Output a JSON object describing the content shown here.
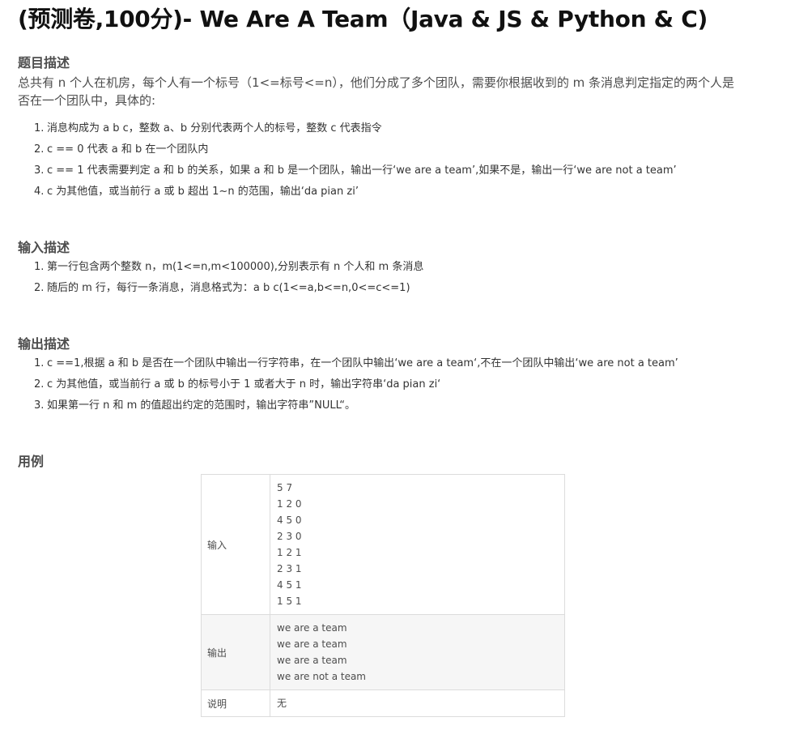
{
  "title": "(预测卷,100分)- We Are A Team（Java & JS & Python & C)",
  "description": {
    "heading": "题目描述",
    "paragraph": "总共有 n 个人在机房，每个人有一个标号（1<=标号<=n），他们分成了多个团队，需要你根据收到的 m 条消息判定指定的两个人是否在一个团队中，具体的:",
    "items": [
      {
        "num": "1.",
        "text": "消息构成为 a b c，整数 a、b 分别代表两个人的标号，整数 c 代表指令"
      },
      {
        "num": "2.",
        "text": "c == 0 代表 a 和 b 在一个团队内"
      },
      {
        "num": "3.",
        "text": "c == 1 代表需要判定 a 和 b 的关系，如果 a 和 b 是一个团队，输出一行‘we are a team’,如果不是，输出一行‘we are not a team’"
      },
      {
        "num": "4.",
        "text": "c 为其他值，或当前行 a 或 b 超出 1~n 的范围，输出‘da pian zi’"
      }
    ]
  },
  "input_desc": {
    "heading": "输入描述",
    "items": [
      {
        "num": "1.",
        "text": "第一行包含两个整数 n，m(1<=n,m<100000),分别表示有 n 个人和 m 条消息"
      },
      {
        "num": "2.",
        "text": "随后的 m 行，每行一条消息，消息格式为：a b c(1<=a,b<=n,0<=c<=1)"
      }
    ]
  },
  "output_desc": {
    "heading": "输出描述",
    "items": [
      {
        "num": "1.",
        "text": "c ==1,根据 a 和 b 是否在一个团队中输出一行字符串，在一个团队中输出‘we are a team‘,不在一个团队中输出‘we are not a team’"
      },
      {
        "num": "2.",
        "text": "c 为其他值，或当前行 a 或 b 的标号小于 1 或者大于 n 时，输出字符串‘da pian zi‘"
      },
      {
        "num": "3.",
        "text": "如果第一行 n 和 m 的值超出约定的范围时，输出字符串”NULL“。"
      }
    ]
  },
  "example": {
    "heading": "用例",
    "input_label": "输入",
    "input_lines": [
      "5 7",
      "1 2 0",
      "4 5 0",
      "2 3 0",
      "1 2 1",
      "2 3 1",
      "4 5 1",
      "1 5 1"
    ],
    "output_label": "输出",
    "output_lines": [
      "we are a team",
      "we are a team",
      "we are a team",
      "we are not a team"
    ],
    "note_label": "说明",
    "note_value": "无"
  }
}
